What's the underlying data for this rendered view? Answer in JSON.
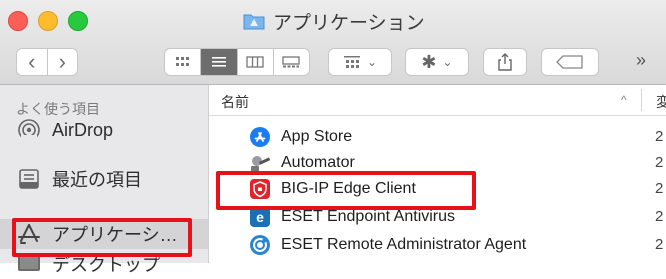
{
  "window": {
    "title": "アプリケーション"
  },
  "toolbar": {
    "back": "‹",
    "forward": "›",
    "overflow": "»",
    "icons": [
      "icon-view",
      "list-view",
      "column-view",
      "gallery-view",
      "group-menu",
      "action-menu",
      "share",
      "tag"
    ]
  },
  "sidebar": {
    "heading": "よく使う項目",
    "items": [
      {
        "label": "AirDrop",
        "icon": "airdrop-icon"
      },
      {
        "label": "最近の項目",
        "icon": "recents-icon"
      },
      {
        "label": "アプリケーシ…",
        "icon": "applications-icon",
        "selected": true
      },
      {
        "label": "デスクトップ",
        "icon": "desktop-icon"
      }
    ]
  },
  "list": {
    "column_name": "名前",
    "column_date": "変",
    "sort_indicator": "^",
    "rows": [
      {
        "name": "App Store",
        "icon": "app-store-icon",
        "date": "2"
      },
      {
        "name": "Automator",
        "icon": "automator-icon",
        "date": "2"
      },
      {
        "name": "BIG-IP Edge Client",
        "icon": "big-ip-icon",
        "date": "2",
        "highlighted": true
      },
      {
        "name": "ESET Endpoint Antivirus",
        "icon": "eset-antivirus-icon",
        "date": "2"
      },
      {
        "name": "ESET Remote Administrator Agent",
        "icon": "eset-agent-icon",
        "date": "2"
      }
    ]
  },
  "colors": {
    "highlight": "#e6121b",
    "accent": "#1a7cf2"
  }
}
